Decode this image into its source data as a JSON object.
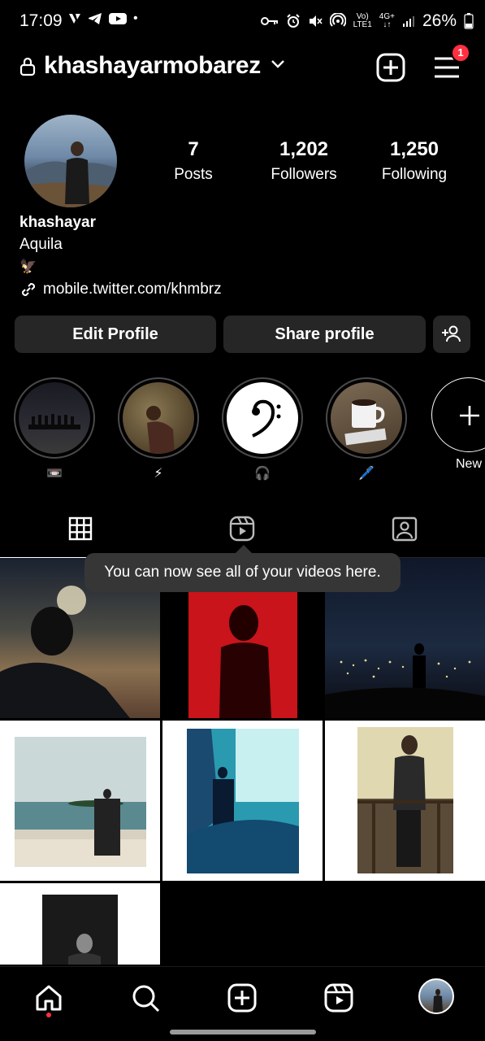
{
  "status_bar": {
    "time": "17:09",
    "network_top": "Vo)",
    "network_bottom": "LTE1",
    "data_top": "4G+",
    "data_bottom": "↓↑",
    "battery": "26%"
  },
  "header": {
    "username": "khashayarmobarez",
    "notification_count": "1"
  },
  "profile": {
    "stats": [
      {
        "value": "7",
        "label": "Posts"
      },
      {
        "value": "1,202",
        "label": "Followers"
      },
      {
        "value": "1,250",
        "label": "Following"
      }
    ],
    "display_name": "khashayar",
    "bio": "Aquila",
    "bio_emoji": "🦅",
    "link": "mobile.twitter.com/khmbrz"
  },
  "buttons": {
    "edit_profile": "Edit Profile",
    "share_profile": "Share profile"
  },
  "highlights": [
    {
      "label": "📼"
    },
    {
      "label": "⚡"
    },
    {
      "label": "🎧"
    },
    {
      "label": "🖊️"
    }
  ],
  "new_highlight_label": "New",
  "tooltip": "You can now see all of your videos here.",
  "colors": {
    "background": "#000000",
    "button_bg": "#262626",
    "badge": "#ff3040",
    "tooltip_bg": "#363636"
  },
  "icons": {
    "tabs": [
      "grid-icon",
      "reels-icon",
      "tagged-icon"
    ],
    "nav": [
      "home-icon",
      "search-icon",
      "create-icon",
      "reels-icon",
      "profile-avatar"
    ]
  }
}
